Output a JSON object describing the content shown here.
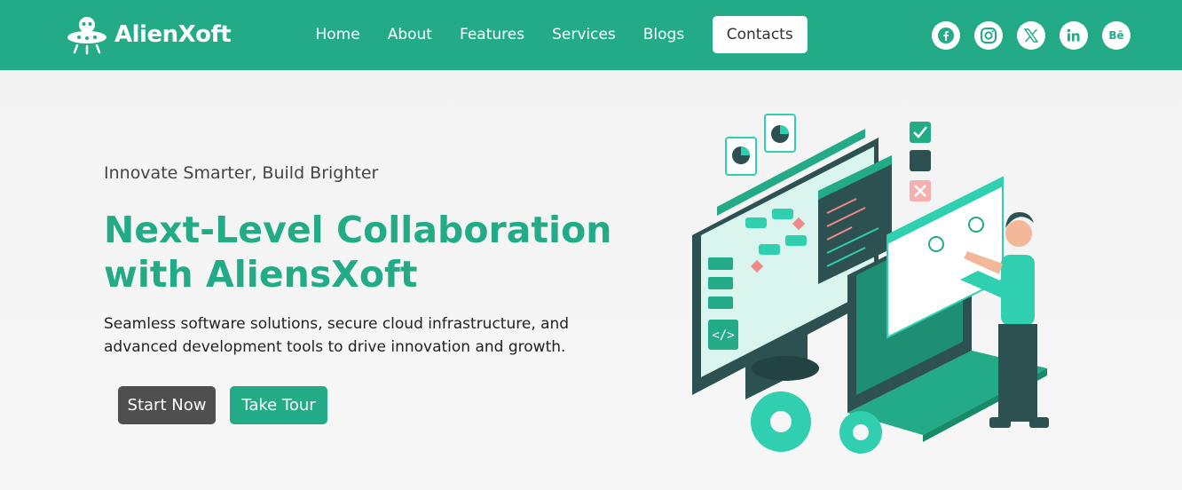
{
  "brand": {
    "name": "AlienXoft",
    "logo_icon": "alien-ufo-icon"
  },
  "nav": {
    "items": [
      {
        "label": "Home"
      },
      {
        "label": "About"
      },
      {
        "label": "Features"
      },
      {
        "label": "Services"
      },
      {
        "label": "Blogs"
      },
      {
        "label": "Contacts"
      }
    ]
  },
  "socials": [
    {
      "icon": "facebook-icon"
    },
    {
      "icon": "instagram-icon"
    },
    {
      "icon": "x-twitter-icon"
    },
    {
      "icon": "linkedin-icon"
    },
    {
      "icon": "behance-icon",
      "label": "Bē"
    }
  ],
  "hero": {
    "tagline": "Innovate Smarter, Build Brighter",
    "headline_line1": "Next-Level Collaboration",
    "headline_line2": "with AliensXoft",
    "subtext": "Seamless software solutions, secure cloud infrastructure, and advanced development tools to drive innovation and growth.",
    "primary_button": "Start Now",
    "secondary_button": "Take Tour",
    "illustration": "developer-workspace-illustration"
  },
  "colors": {
    "brand": "#23ab87",
    "dark_button": "#4f4f4f",
    "nav_active_bg": "#ffffff",
    "body_text": "#222222"
  }
}
